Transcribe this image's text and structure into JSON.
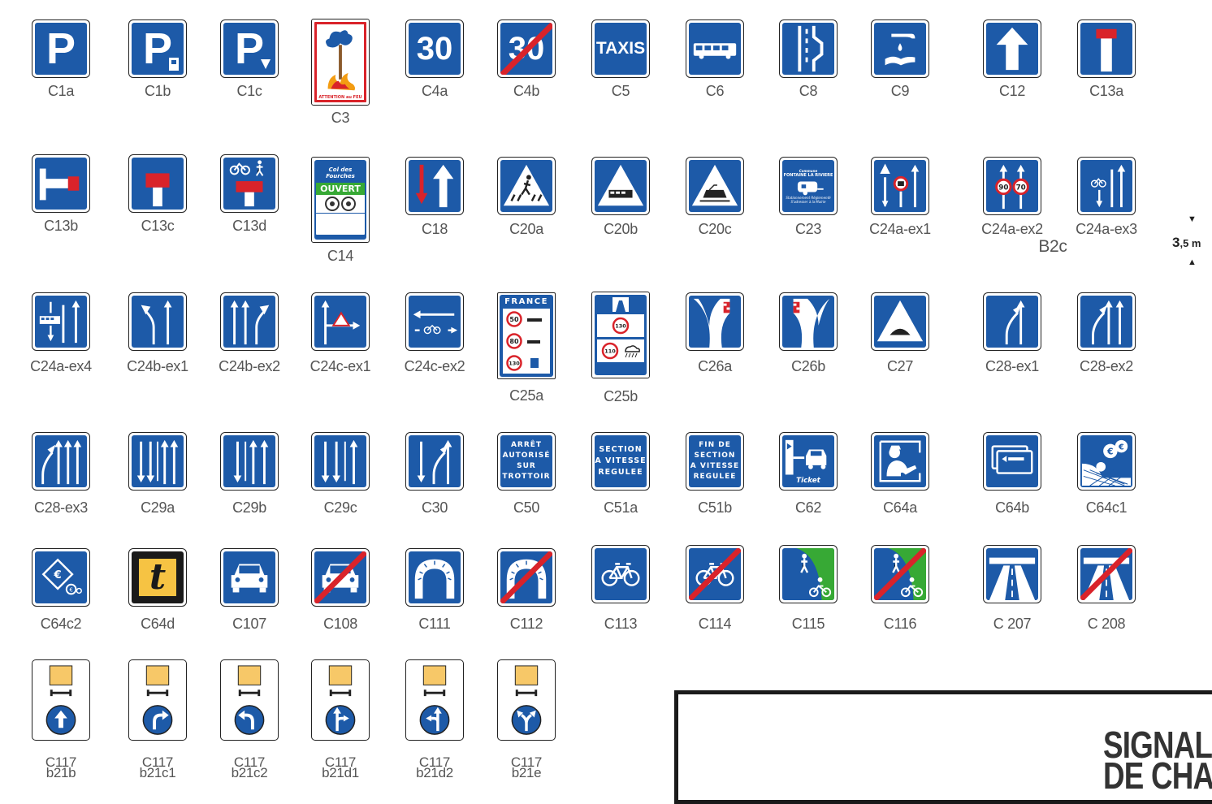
{
  "labels": {
    "C1a": "C1a",
    "C1b": "C1b",
    "C1c": "C1c",
    "C3": "C3",
    "C4a": "C4a",
    "C4b": "C4b",
    "C5": "C5",
    "C6": "C6",
    "C8": "C8",
    "C9": "C9",
    "C12": "C12",
    "C13a": "C13a",
    "C13b": "C13b",
    "C13c": "C13c",
    "C13d": "C13d",
    "C14": "C14",
    "C18": "C18",
    "C20a": "C20a",
    "C20b": "C20b",
    "C20c": "C20c",
    "C23": "C23",
    "C24a_ex1": "C24a-ex1",
    "C24a_ex2": "C24a-ex2",
    "C24a_ex3": "C24a-ex3",
    "B2c": "B2c",
    "C24a_ex4": "C24a-ex4",
    "C24b_ex1": "C24b-ex1",
    "C24b_ex2": "C24b-ex2",
    "C24c_ex1": "C24c-ex1",
    "C24c_ex2": "C24c-ex2",
    "C25a": "C25a",
    "C25b": "C25b",
    "C26a": "C26a",
    "C26b": "C26b",
    "C27": "C27",
    "C28_ex1": "C28-ex1",
    "C28_ex2": "C28-ex2",
    "C28_ex3": "C28-ex3",
    "C29a": "C29a",
    "C29b": "C29b",
    "C29c": "C29c",
    "C30": "C30",
    "C50": "C50",
    "C51a": "C51a",
    "C51b": "C51b",
    "C62": "C62",
    "C64a": "C64a",
    "C64b": "C64b",
    "C64c1": "C64c1",
    "C64c2": "C64c2",
    "C64d": "C64d",
    "C107": "C107",
    "C108": "C108",
    "C111": "C111",
    "C112": "C112",
    "C113": "C113",
    "C114": "C114",
    "C115": "C115",
    "C116": "C116",
    "C207": "C 207",
    "C208": "C 208",
    "C117_b21b": [
      "C117",
      "b21b"
    ],
    "C117_b21c1": [
      "C117",
      "b21c1"
    ],
    "C117_b21c2": [
      "C117",
      "b21c2"
    ],
    "C117_b21d1": [
      "C117",
      "b21d1"
    ],
    "C117_b21d2": [
      "C117",
      "b21d2"
    ],
    "C117_b21e": [
      "C117",
      "b21e"
    ]
  },
  "sign_text": {
    "p": "P",
    "c3_caption": "ATTENTION au FEU",
    "c4": "30",
    "c5": "TAXIS",
    "c14_head": "Col des Fourches",
    "c14_status": "OUVERT",
    "c23_top": "Commune",
    "c23_name": "FONTAINE LA RIVIERE",
    "c23_line1": "Stationnement Réglementé",
    "c23_line2": "S'adresser à la Mairie",
    "c24_speed1": "90",
    "c24_speed2": "70",
    "c25a_country": "FRANCE",
    "c25a_s1": "50",
    "c25a_s2": "80",
    "c25a_s3": "130",
    "c25b_s1": "130",
    "c25b_s2": "110",
    "c50": [
      "ARRÊT",
      "AUTORISÉ",
      "SUR",
      "TROTTOIR"
    ],
    "c51a": [
      "SECTION",
      "A VITESSE",
      "REGULEE"
    ],
    "c51b": [
      "FIN DE",
      "SECTION",
      "A VITESSE",
      "REGULEE"
    ],
    "c62": "Ticket",
    "c64d": "t",
    "c64c2": "€",
    "c64c1": "€"
  },
  "scale": {
    "value": "3",
    "unit": ",5 m"
  },
  "title": {
    "line1": "SIGNALIS",
    "line2": "DE CHAUS"
  },
  "colors": {
    "sign_blue": "#1d5aa8",
    "red": "#d9232a",
    "yellow": "#f6c343",
    "green": "#37a935",
    "orange_plate": "#f7c868"
  }
}
